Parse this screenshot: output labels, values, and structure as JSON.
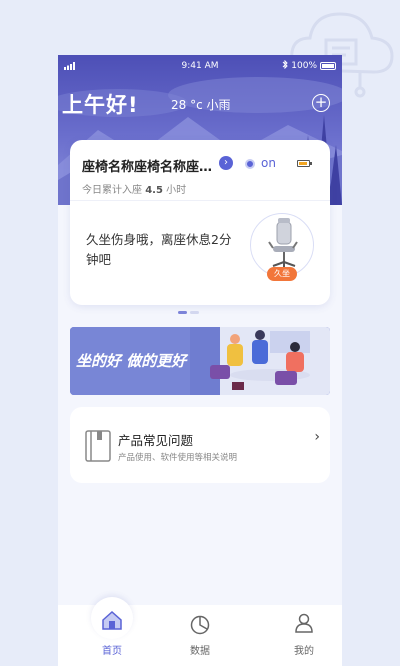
{
  "status_bar": {
    "time": "9:41 AM",
    "battery": "100%"
  },
  "header": {
    "greeting": "上午好!",
    "temperature": "28 °c",
    "weather": "小雨"
  },
  "chair_card": {
    "name": "座椅名称座椅名称座椅名称",
    "power": "on",
    "today_prefix": "今日累计入座",
    "today_hours": "4.5",
    "today_unit": "小时",
    "warning": "久坐伤身哦，离座休息2分钟吧",
    "badge": "久坐"
  },
  "banner": {
    "text": "坐的好  做的更好"
  },
  "faq": {
    "title": "产品常见问题",
    "subtitle": "产品使用、软件使用等相关说明"
  },
  "tabbar": {
    "home": "首页",
    "data": "数据",
    "mine": "我的"
  },
  "colors": {
    "primary": "#5a63d6",
    "header": "#4d4fb6",
    "badge": "#f2763a"
  }
}
